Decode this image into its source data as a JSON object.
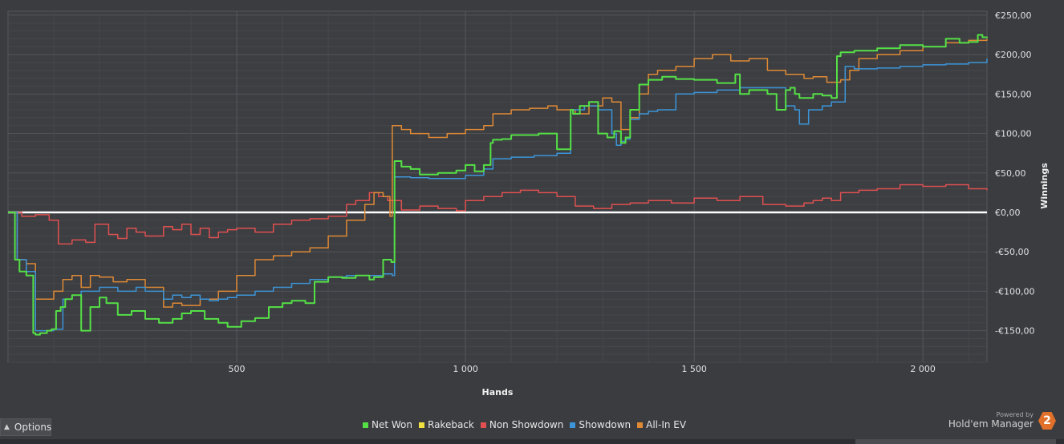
{
  "chart_data": {
    "type": "line",
    "xlabel": "Hands",
    "ylabel": "Winnings",
    "xlim": [
      0,
      2140
    ],
    "ylim": [
      -190,
      255
    ],
    "x_ticks": [
      500,
      1000,
      1500,
      2000
    ],
    "x_tick_labels": [
      "500",
      "1 000",
      "1 500",
      "2 000"
    ],
    "y_ticks": [
      250,
      200,
      150,
      100,
      50,
      0,
      -50,
      -100,
      -150
    ],
    "y_tick_labels": [
      "€250,00",
      "€200,00",
      "€150,00",
      "€100,00",
      "€50,00",
      "€0,00",
      "-€50,00",
      "-€100,00",
      "-€150,00"
    ],
    "legend_position": "bottom-center",
    "grid": true,
    "series": [
      {
        "name": "Net Won",
        "color": "#55e046",
        "x": [
          0,
          15,
          25,
          40,
          55,
          60,
          70,
          85,
          95,
          105,
          115,
          125,
          140,
          160,
          180,
          200,
          215,
          240,
          270,
          300,
          330,
          345,
          360,
          380,
          400,
          430,
          460,
          480,
          510,
          540,
          570,
          600,
          620,
          650,
          670,
          700,
          730,
          760,
          790,
          800,
          820,
          838,
          845,
          860,
          880,
          900,
          940,
          980,
          1000,
          1020,
          1040,
          1055,
          1060,
          1080,
          1100,
          1160,
          1200,
          1230,
          1235,
          1250,
          1270,
          1290,
          1310,
          1325,
          1340,
          1350,
          1360,
          1380,
          1400,
          1430,
          1460,
          1500,
          1550,
          1590,
          1600,
          1620,
          1660,
          1680,
          1700,
          1710,
          1720,
          1730,
          1740,
          1760,
          1780,
          1800,
          1812,
          1820,
          1850,
          1900,
          1950,
          2000,
          2050,
          2080,
          2100,
          2120,
          2130,
          2140
        ],
        "y": [
          0,
          -60,
          -75,
          -80,
          -153,
          -155,
          -153,
          -150,
          -148,
          -125,
          -120,
          -110,
          -105,
          -150,
          -120,
          -108,
          -115,
          -130,
          -125,
          -135,
          -140,
          -140,
          -135,
          -128,
          -125,
          -135,
          -140,
          -145,
          -138,
          -134,
          -120,
          -115,
          -112,
          -115,
          -88,
          -82,
          -83,
          -80,
          -85,
          -82,
          -60,
          -63,
          65,
          58,
          55,
          48,
          50,
          53,
          60,
          52,
          60,
          88,
          92,
          93,
          98,
          100,
          80,
          130,
          125,
          135,
          140,
          100,
          95,
          103,
          88,
          95,
          130,
          162,
          168,
          172,
          169,
          168,
          164,
          175,
          150,
          155,
          150,
          130,
          155,
          158,
          150,
          145,
          145,
          150,
          148,
          145,
          198,
          203,
          205,
          208,
          212,
          210,
          220,
          215,
          216,
          225,
          222,
          221
        ]
      },
      {
        "name": "Rakeback",
        "color": "#f0e040",
        "x": [
          0,
          2140
        ],
        "y": [
          0,
          0
        ]
      },
      {
        "name": "Non Showdown",
        "color": "#e05050",
        "x": [
          0,
          30,
          60,
          90,
          110,
          140,
          170,
          190,
          220,
          240,
          260,
          280,
          300,
          340,
          360,
          380,
          400,
          420,
          440,
          460,
          480,
          500,
          540,
          580,
          620,
          660,
          700,
          740,
          760,
          790,
          810,
          830,
          860,
          900,
          940,
          980,
          1000,
          1040,
          1080,
          1120,
          1160,
          1200,
          1240,
          1280,
          1320,
          1360,
          1400,
          1450,
          1500,
          1550,
          1600,
          1650,
          1700,
          1740,
          1760,
          1780,
          1800,
          1820,
          1860,
          1900,
          1950,
          2000,
          2050,
          2100,
          2140
        ],
        "y": [
          0,
          -5,
          -3,
          -10,
          -40,
          -35,
          -38,
          -15,
          -28,
          -33,
          -20,
          -25,
          -30,
          -18,
          -22,
          -15,
          -28,
          -20,
          -32,
          -25,
          -22,
          -20,
          -25,
          -15,
          -10,
          -8,
          -5,
          10,
          15,
          25,
          20,
          15,
          3,
          8,
          5,
          2,
          15,
          20,
          25,
          28,
          25,
          20,
          8,
          5,
          10,
          12,
          15,
          12,
          18,
          15,
          20,
          10,
          8,
          12,
          15,
          18,
          15,
          25,
          28,
          30,
          35,
          33,
          35,
          30,
          28
        ]
      },
      {
        "name": "Showdown",
        "color": "#3d95d8",
        "x": [
          0,
          20,
          40,
          60,
          80,
          100,
          120,
          140,
          160,
          200,
          240,
          280,
          300,
          340,
          360,
          380,
          400,
          420,
          440,
          460,
          480,
          500,
          540,
          580,
          620,
          660,
          700,
          740,
          780,
          820,
          840,
          845,
          880,
          920,
          960,
          1000,
          1040,
          1060,
          1100,
          1150,
          1200,
          1230,
          1260,
          1290,
          1320,
          1330,
          1340,
          1350,
          1360,
          1380,
          1400,
          1420,
          1460,
          1500,
          1550,
          1600,
          1650,
          1700,
          1720,
          1730,
          1750,
          1780,
          1800,
          1830,
          1850,
          1900,
          1950,
          2000,
          2050,
          2100,
          2140
        ],
        "y": [
          0,
          -60,
          -75,
          -150,
          -150,
          -148,
          -110,
          -105,
          -100,
          -95,
          -100,
          -95,
          -100,
          -110,
          -105,
          -108,
          -105,
          -110,
          -112,
          -110,
          -108,
          -105,
          -100,
          -95,
          -90,
          -85,
          -82,
          -80,
          -80,
          -78,
          -80,
          45,
          44,
          43,
          43,
          47,
          55,
          68,
          70,
          72,
          75,
          130,
          135,
          130,
          100,
          85,
          90,
          93,
          118,
          125,
          128,
          130,
          150,
          152,
          155,
          158,
          158,
          135,
          130,
          112,
          130,
          135,
          140,
          185,
          182,
          183,
          185,
          187,
          188,
          190,
          195
        ]
      },
      {
        "name": "All-In EV",
        "color": "#e08a35",
        "x": [
          0,
          20,
          40,
          60,
          80,
          100,
          120,
          140,
          160,
          180,
          200,
          230,
          260,
          300,
          340,
          360,
          380,
          420,
          460,
          500,
          540,
          580,
          620,
          660,
          700,
          740,
          780,
          800,
          820,
          835,
          840,
          860,
          880,
          920,
          960,
          1000,
          1040,
          1060,
          1100,
          1140,
          1180,
          1200,
          1240,
          1270,
          1300,
          1320,
          1340,
          1360,
          1380,
          1400,
          1420,
          1460,
          1500,
          1540,
          1580,
          1620,
          1660,
          1700,
          1740,
          1760,
          1790,
          1820,
          1840,
          1860,
          1900,
          1950,
          2000,
          2050,
          2100,
          2140
        ],
        "y": [
          0,
          -60,
          -65,
          -110,
          -110,
          -100,
          -85,
          -80,
          -95,
          -80,
          -82,
          -88,
          -85,
          -95,
          -120,
          -115,
          -118,
          -110,
          -100,
          -80,
          -60,
          -55,
          -50,
          -45,
          -30,
          -10,
          10,
          25,
          20,
          -5,
          110,
          105,
          100,
          95,
          100,
          105,
          110,
          125,
          130,
          132,
          135,
          130,
          125,
          135,
          145,
          140,
          105,
          120,
          150,
          175,
          180,
          185,
          195,
          200,
          192,
          195,
          180,
          175,
          170,
          172,
          165,
          168,
          180,
          195,
          200,
          205,
          210,
          215,
          218,
          220
        ]
      }
    ]
  },
  "options": {
    "label": "Options"
  },
  "legend": [
    {
      "label": "Net Won",
      "color": "#55e046"
    },
    {
      "label": "Rakeback",
      "color": "#f0e040"
    },
    {
      "label": "Non Showdown",
      "color": "#e05050"
    },
    {
      "label": "Showdown",
      "color": "#3d95d8"
    },
    {
      "label": "All-In EV",
      "color": "#e08a35"
    }
  ],
  "branding": {
    "powered_by": "Powered by",
    "name": "Hold'em Manager",
    "badge": "2"
  }
}
